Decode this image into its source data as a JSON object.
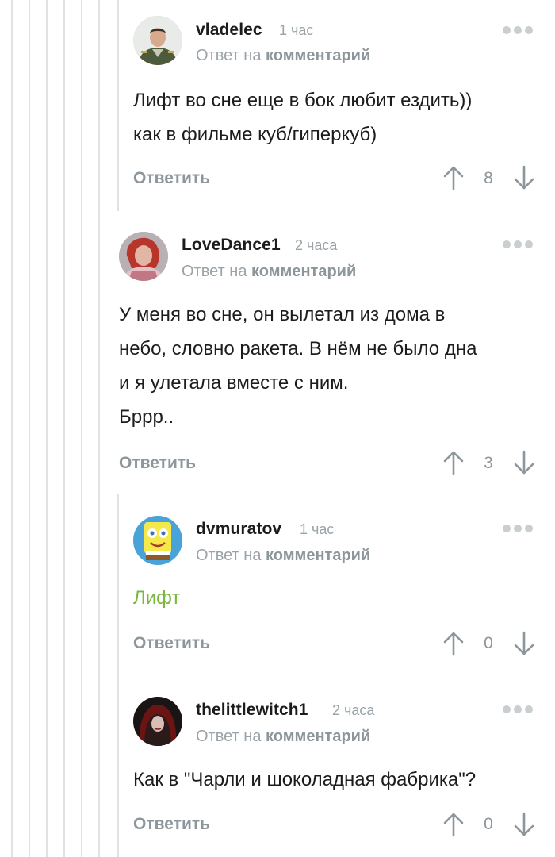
{
  "comments": [
    {
      "author": "vladelec",
      "time": "1 час",
      "reply_prefix": "Ответ на",
      "reply_link": "комментарий",
      "text": "Лифт во сне еще в бок любит ездить))\nкак в фильме куб/гиперкуб)",
      "reply_label": "Ответить",
      "rating": "8"
    },
    {
      "author": "LoveDance1",
      "time": "2 часа",
      "reply_prefix": "Ответ на",
      "reply_link": "комментарий",
      "text": "У меня во сне, он вылетал из дома в\nнебо, словно ракета. В нём не было дна\nи я улетала вместе с ним.\nБррр..",
      "reply_label": "Ответить",
      "rating": "3"
    },
    {
      "author": "dvmuratov",
      "time": "1 час",
      "reply_prefix": "Ответ на",
      "reply_link": "комментарий",
      "text": "Лифт",
      "text_color": "#7ab73e",
      "reply_label": "Ответить",
      "rating": "0"
    },
    {
      "author": "thelittlewitch1",
      "time": "2 часа",
      "reply_prefix": "Ответ на",
      "reply_link": "комментарий",
      "text": "Как в \"Чарли и шоколадная фабрика\"?",
      "reply_label": "Ответить",
      "rating": "0"
    }
  ],
  "colors": {
    "accent_green": "#7ab73e",
    "muted": "#8c969b",
    "thread_line": "#dfe3e6"
  },
  "icons": {
    "upvote": "arrow-up-icon",
    "downvote": "arrow-down-icon",
    "more": "more-dots-icon"
  }
}
